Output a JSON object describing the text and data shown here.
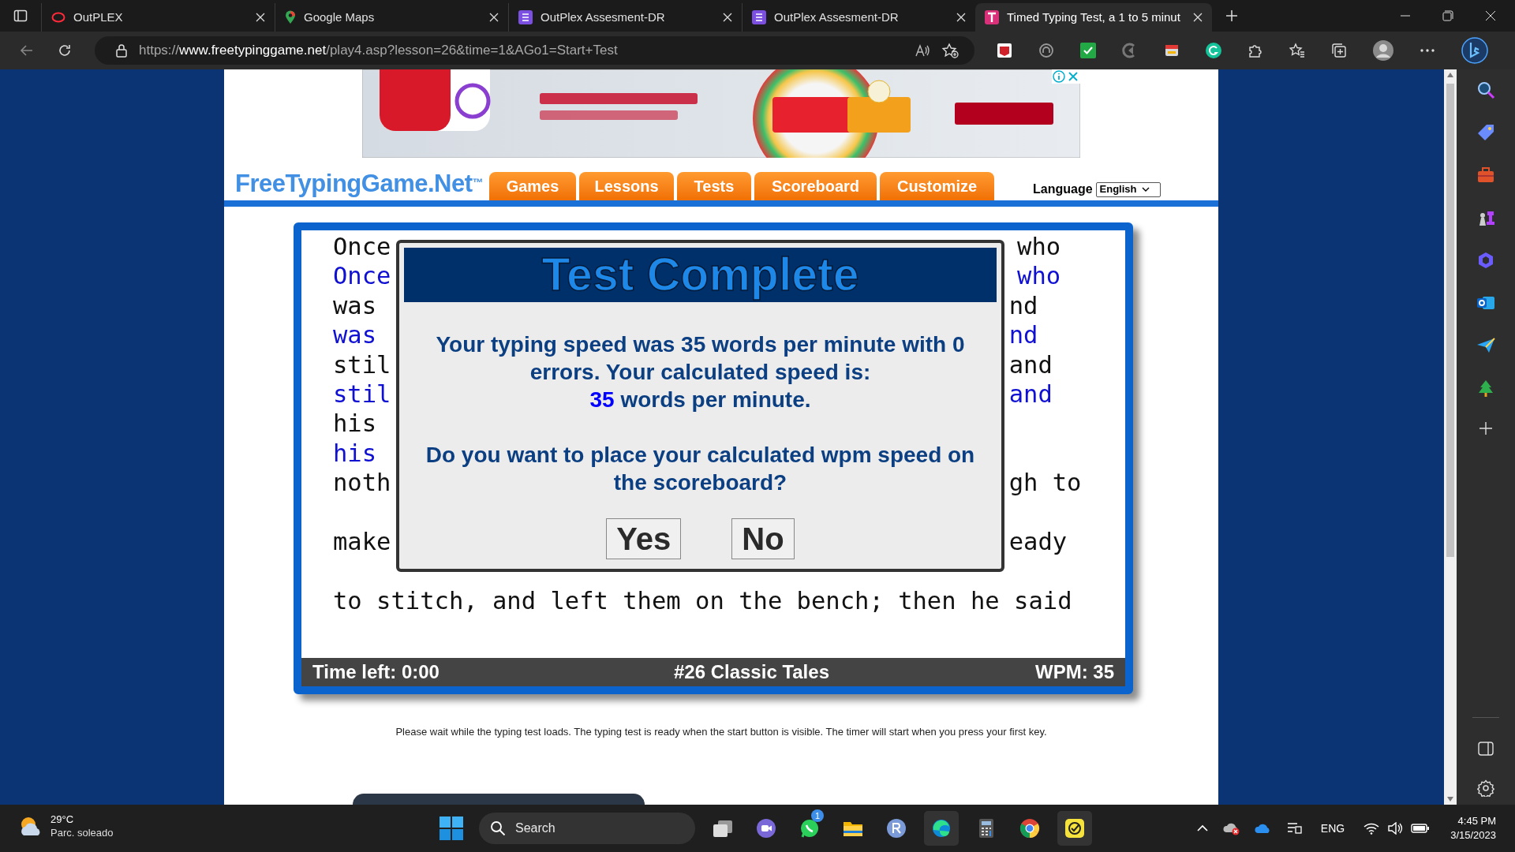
{
  "browser": {
    "tabs": [
      {
        "title": "OutPLEX",
        "selected": false
      },
      {
        "title": "Google Maps",
        "selected": false
      },
      {
        "title": "OutPlex Assesment-DR",
        "selected": false
      },
      {
        "title": "OutPlex Assesment-DR",
        "selected": false
      },
      {
        "title": "Timed Typing Test, a 1 to 5 minut",
        "selected": true
      }
    ],
    "url": {
      "scheme": "https://",
      "domain": "www.freetypinggame.net",
      "path": "/play4.asp?lesson=26&time=1&AGo1=Start+Test"
    }
  },
  "site": {
    "logo": "FreeTypingGame.Net$^{™}$",
    "nav": [
      "Games",
      "Lessons",
      "Tests",
      "Scoreboard",
      "Customize"
    ],
    "language_label": "Language",
    "language_value": "English"
  },
  "typing": {
    "lines": [
      {
        "kind": "source",
        "left": "Once",
        "right": "who"
      },
      {
        "kind": "typed",
        "left": "Once",
        "right": "who"
      },
      {
        "kind": "source",
        "left": "was",
        "right": "nd"
      },
      {
        "kind": "typed",
        "left": "was",
        "right": "nd"
      },
      {
        "kind": "source",
        "left": "stil",
        "right": "and"
      },
      {
        "kind": "typed",
        "left": "stil",
        "right": "and"
      },
      {
        "kind": "source",
        "left": "his"
      },
      {
        "kind": "typed",
        "left": "his"
      },
      {
        "kind": "source",
        "left": "noth",
        "right": "gh to"
      },
      {
        "kind": "blank"
      },
      {
        "kind": "source",
        "left": "make",
        "right": "eady"
      },
      {
        "kind": "blank"
      },
      {
        "kind": "source",
        "left": "to stitch, and left them on the bench; then he said"
      }
    ],
    "status_bar": {
      "time_left": "Time left: 0:00",
      "lesson": "#26 Classic Tales",
      "wpm": "WPM: 35"
    }
  },
  "dialog": {
    "title": "Test Complete",
    "message": "Your typing speed was 35 words per minute with 0 errors. Your calculated speed is:",
    "speed": "35",
    "speed_unit": "words per minute.",
    "question": "Do you want to place your calculated wpm speed on the scoreboard?",
    "buttons": [
      "Yes",
      "No"
    ]
  },
  "notice": "Please wait while the typing test loads. The typing test is ready when the start button is visible. The timer will start when you press your first key.",
  "taskbar": {
    "weather_temp": "29°C",
    "weather_text": "Parc. soleado",
    "search": "Search",
    "whatsapp_badge": "1",
    "language": "ENG",
    "time": "4:45 PM",
    "date": "3/15/2023"
  }
}
